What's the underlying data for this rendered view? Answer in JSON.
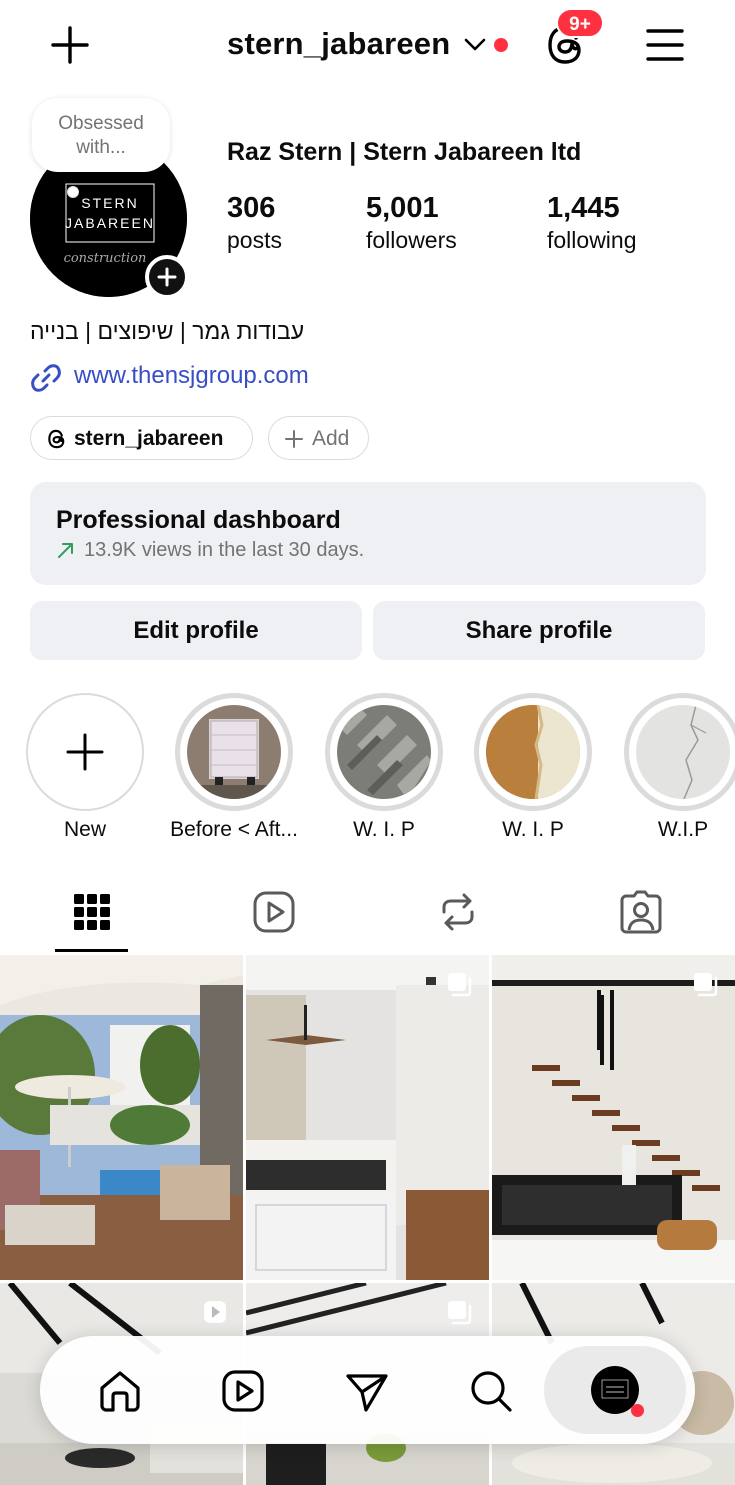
{
  "header": {
    "username": "stern_jabareen",
    "notification_badge": "9+",
    "icons": [
      "plus-icon",
      "chevron-down-icon",
      "threads-icon",
      "menu-icon"
    ],
    "accent_red": "#ff3040"
  },
  "profile": {
    "note_line1": "Obsessed",
    "note_line2": "with...",
    "avatar_text_line1": "STERN",
    "avatar_text_line2": "JABAREEN",
    "avatar_script": "construction",
    "display_name": "Raz Stern | Stern Jabareen ltd",
    "stats": {
      "posts_count": "306",
      "posts_label": "posts",
      "followers_count": "5,001",
      "followers_label": "followers",
      "following_count": "1,445",
      "following_label": "following"
    },
    "bio": "עבודות גמר | שיפוצים | בנייה",
    "link": "www.thensjgroup.com",
    "link_color": "#384ec4",
    "threads_pill": "stern_jabareen",
    "add_pill": "Add"
  },
  "dashboard": {
    "title": "Professional dashboard",
    "subtitle": "13.9K views in the last 30 days.",
    "trend_color": "#2e9e5b"
  },
  "buttons": {
    "edit": "Edit profile",
    "share": "Share profile"
  },
  "highlights": [
    {
      "label": "New"
    },
    {
      "label": "Before < Aft..."
    },
    {
      "label": "W. I. P"
    },
    {
      "label": "W. I. P"
    },
    {
      "label": "W.I.P"
    }
  ],
  "tabs": [
    "grid-icon",
    "reels-icon",
    "reposts-icon",
    "tagged-icon"
  ],
  "nav": [
    "home-icon",
    "reels-icon",
    "send-icon",
    "search-icon",
    "profile-avatar"
  ]
}
